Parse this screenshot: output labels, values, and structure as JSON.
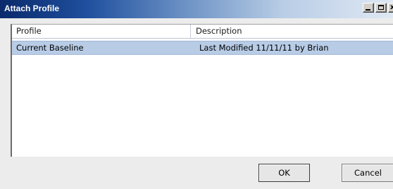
{
  "window": {
    "title": "Attach Profile",
    "controls": {
      "minimize": "minimize-icon",
      "maximize": "maximize-icon",
      "close_glyph": "x"
    }
  },
  "list": {
    "columns": [
      "Profile",
      "Description"
    ],
    "rows": [
      {
        "profile": "Current Baseline",
        "description": "Last Modified 11/11/11 by Brian",
        "selected": true
      }
    ]
  },
  "buttons": {
    "ok": "OK",
    "cancel": "Cancel"
  },
  "colors": {
    "title_gradient_start": "#0a2a6b",
    "title_gradient_end": "#dfe8f3",
    "selection": "#b8cce6",
    "dialog_background": "#ececec"
  }
}
